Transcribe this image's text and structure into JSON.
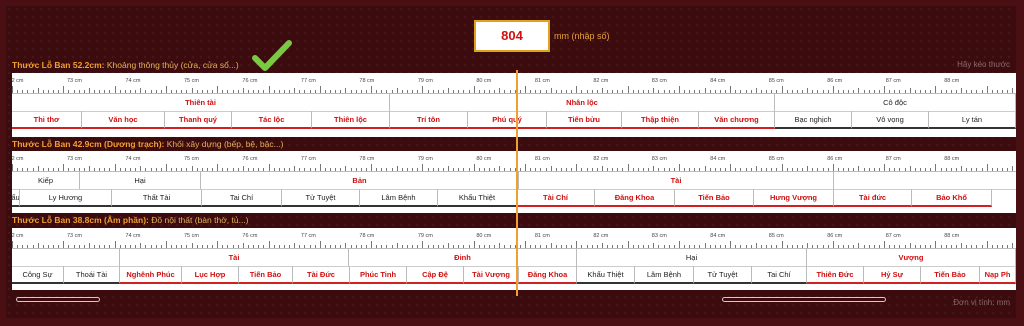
{
  "input": {
    "value": "804",
    "unit": "mm (nhập số)"
  },
  "drag_hint": "Hãy kéo thước",
  "unit_note": "Đơn vị tính: mm",
  "colors": {
    "good": "#d01010",
    "bad": "#222222",
    "accent": "#f0a030"
  },
  "scale_labels": [
    "72 cm",
    "73 cm",
    "74 cm",
    "75 cm",
    "76 cm",
    "77 cm",
    "78 cm",
    "79 cm",
    "80 cm",
    "81 cm",
    "82 cm",
    "83 cm",
    "84 cm",
    "85 cm",
    "86 cm",
    "87 cm",
    "88 cm"
  ],
  "rulers": [
    {
      "title": "Thước Lỗ Ban 52.2cm:",
      "desc": "Khoảng thông thủy (cửa, cửa sổ...)",
      "main": [
        {
          "label": "Thiên tài",
          "good": true
        },
        {
          "label": "Nhân lộc",
          "good": true
        },
        {
          "label": "Cô độc",
          "good": false
        }
      ],
      "sub": [
        {
          "label": "Thi thơ",
          "good": true
        },
        {
          "label": "Văn học",
          "good": true
        },
        {
          "label": "Thanh quý",
          "good": true
        },
        {
          "label": "Tác lộc",
          "good": true
        },
        {
          "label": "Thiên lộc",
          "good": true
        },
        {
          "label": "Trí tôn",
          "good": true
        },
        {
          "label": "Phú quý",
          "good": true
        },
        {
          "label": "Tiến bửu",
          "good": true
        },
        {
          "label": "Thập thiện",
          "good": true
        },
        {
          "label": "Văn chương",
          "good": true
        },
        {
          "label": "Bạc nghịch",
          "good": false
        },
        {
          "label": "Vô vọng",
          "good": false
        },
        {
          "label": "Ly tán",
          "good": false
        }
      ]
    },
    {
      "title": "Thước Lỗ Ban 42.9cm (Dương trạch):",
      "desc": "Khối xây dựng (bếp, bệ, bậc...)",
      "main": [
        {
          "label": "Kiếp",
          "good": false
        },
        {
          "label": "Hại",
          "good": false
        },
        {
          "label": "Bản",
          "good": true
        },
        {
          "label": "Tài",
          "good": true
        }
      ],
      "sub": [
        {
          "label": "ẩu",
          "good": false
        },
        {
          "label": "Ly Hương",
          "good": false
        },
        {
          "label": "Thất Tài",
          "good": false
        },
        {
          "label": "Tai Chí",
          "good": false
        },
        {
          "label": "Tử Tuyệt",
          "good": false
        },
        {
          "label": "Lâm Bệnh",
          "good": false
        },
        {
          "label": "Khẩu Thiệt",
          "good": false
        },
        {
          "label": "Tài Chí",
          "good": true
        },
        {
          "label": "Đăng Khoa",
          "good": true
        },
        {
          "label": "Tiến Bảo",
          "good": true
        },
        {
          "label": "Hưng Vượng",
          "good": true
        },
        {
          "label": "Tài đức",
          "good": true
        },
        {
          "label": "Bảo Khố",
          "good": true
        }
      ]
    },
    {
      "title": "Thước Lỗ Ban 38.8cm (Âm phần):",
      "desc": "Đồ nội thất (bàn thờ, tủ...)",
      "main": [
        {
          "label": "",
          "good": false
        },
        {
          "label": "Tài",
          "good": true
        },
        {
          "label": "Đinh",
          "good": true
        },
        {
          "label": "Hại",
          "good": false
        },
        {
          "label": "Vượng",
          "good": true
        }
      ],
      "sub": [
        {
          "label": "Công Sự",
          "good": false
        },
        {
          "label": "Thoái Tài",
          "good": false
        },
        {
          "label": "Nghênh Phúc",
          "good": true
        },
        {
          "label": "Lục Hợp",
          "good": true
        },
        {
          "label": "Tiến Bảo",
          "good": true
        },
        {
          "label": "Tài Đức",
          "good": true
        },
        {
          "label": "Phúc Tinh",
          "good": true
        },
        {
          "label": "Cập Đệ",
          "good": true
        },
        {
          "label": "Tài Vượng",
          "good": true
        },
        {
          "label": "Đăng Khoa",
          "good": true
        },
        {
          "label": "Khẩu Thiệt",
          "good": false
        },
        {
          "label": "Lâm Bệnh",
          "good": false
        },
        {
          "label": "Tử Tuyệt",
          "good": false
        },
        {
          "label": "Tai Chí",
          "good": false
        },
        {
          "label": "Thiên Đức",
          "good": true
        },
        {
          "label": "Hỷ Sự",
          "good": true
        },
        {
          "label": "Tiến Bảo",
          "good": true
        },
        {
          "label": "Nạp Ph",
          "good": true
        }
      ]
    }
  ]
}
